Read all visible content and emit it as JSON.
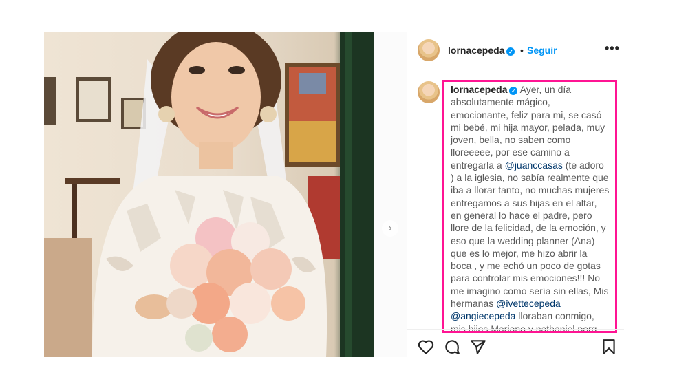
{
  "post": {
    "username": "lornacepeda",
    "separator": "•",
    "follow_label": "Seguir",
    "more_label": "•••",
    "verified_icon": "verified-badge-icon",
    "next_icon": "chevron-right-icon"
  },
  "caption": {
    "username": "lornacepeda",
    "text_1": "Ayer, un día absolutamente mágico, emocionante, feliz para mi, se casó mi bebé, mi hija mayor, pelada, muy joven, bella, no saben como lloreeeee, por ese camino a entregarla a ",
    "mention_1": "@juanccasas",
    "text_2": " (te adoro ) a la iglesia, no sabía realmente que iba a llorar tanto, no muchas mujeres entregamos a sus hijas en el altar, en general lo hace el padre, pero llore de la felicidad, de la emoción, y eso que la wedding planner (Ana) que es lo mejor, me hizo abrir la boca , y me echó un poco de gotas para controlar mis emociones!!! No me imagino como sería sin ellas, Mis hermanas ",
    "mention_2": "@ivettecepeda",
    "mention_3": "@angiecepeda",
    "text_3": " lloraban conmigo, mis hijos Mariano y nathaniel,porq entendían las razones, solo les digo, como les afirmé en un post pasado, todo lo que uno pasa"
  },
  "actions": {
    "icons": [
      "heart-icon",
      "comment-icon",
      "share-icon",
      "bookmark-icon"
    ]
  },
  "colors": {
    "accent": "#0095f6",
    "highlight_border": "#ff1493",
    "text": "#262626"
  }
}
